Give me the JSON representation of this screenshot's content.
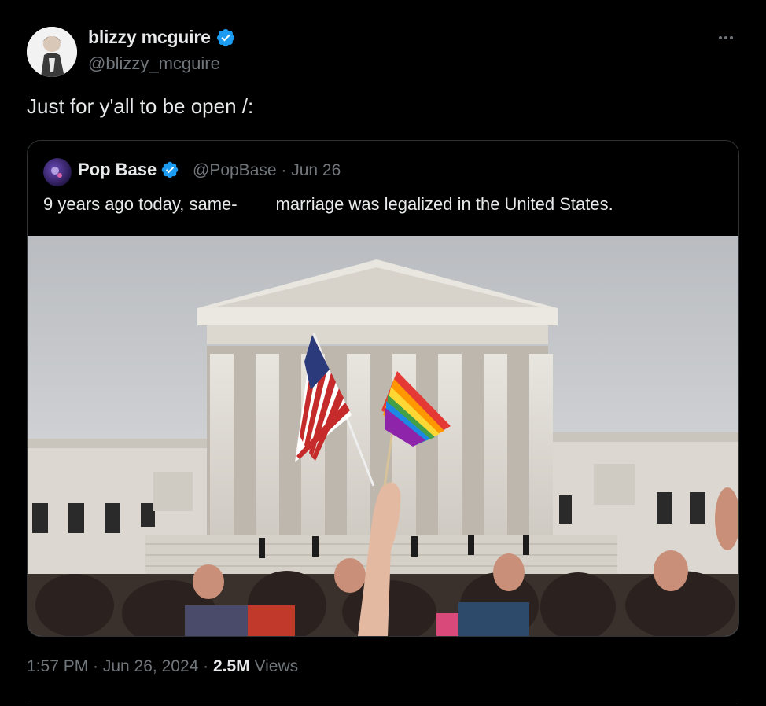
{
  "author": {
    "name": "blizzy mcguire",
    "handle": "@blizzy_mcguire",
    "verified_color": "#1d9bf0"
  },
  "tweet": {
    "text": "Just for y'all to be open /:"
  },
  "quoted_tweet": {
    "name": "Pop Base",
    "handle": "@PopBase",
    "date": "Jun 26",
    "text": "9 years ago today, same-        marriage was legalized in the United States."
  },
  "meta": {
    "time_date": "1:57 PM · Jun 26, 2024 · ",
    "views_count": "2.5M",
    "views_label": " Views"
  },
  "icons": {
    "verified": "verified-badge-icon",
    "more": "more-options-icon"
  }
}
